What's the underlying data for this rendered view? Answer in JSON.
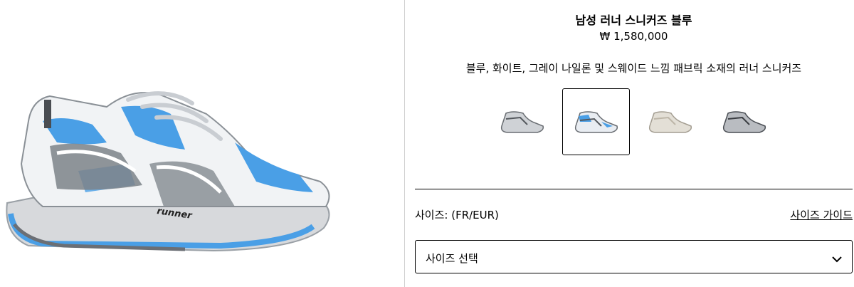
{
  "product": {
    "title": "남성 러너 스니커즈 블루",
    "price": "₩ 1,580,000",
    "description": "블루, 화이트, 그레이 나일론 및 스웨이드 느낌 패브릭 소재의 러너 스니커즈",
    "image_logo_text": "runner"
  },
  "colors": {
    "accent": "#4a9fe6",
    "border": "#000000",
    "divider": "#cfcfcf"
  },
  "swatches": [
    {
      "name": "silver",
      "selected": false
    },
    {
      "name": "blue",
      "selected": true
    },
    {
      "name": "beige",
      "selected": false
    },
    {
      "name": "grey",
      "selected": false
    }
  ],
  "size": {
    "label": "사이즈: (FR/EUR)",
    "guide_label": "사이즈 가이드",
    "select_value": "사이즈 선택",
    "dropdown_icon": "chevron-down-icon"
  }
}
